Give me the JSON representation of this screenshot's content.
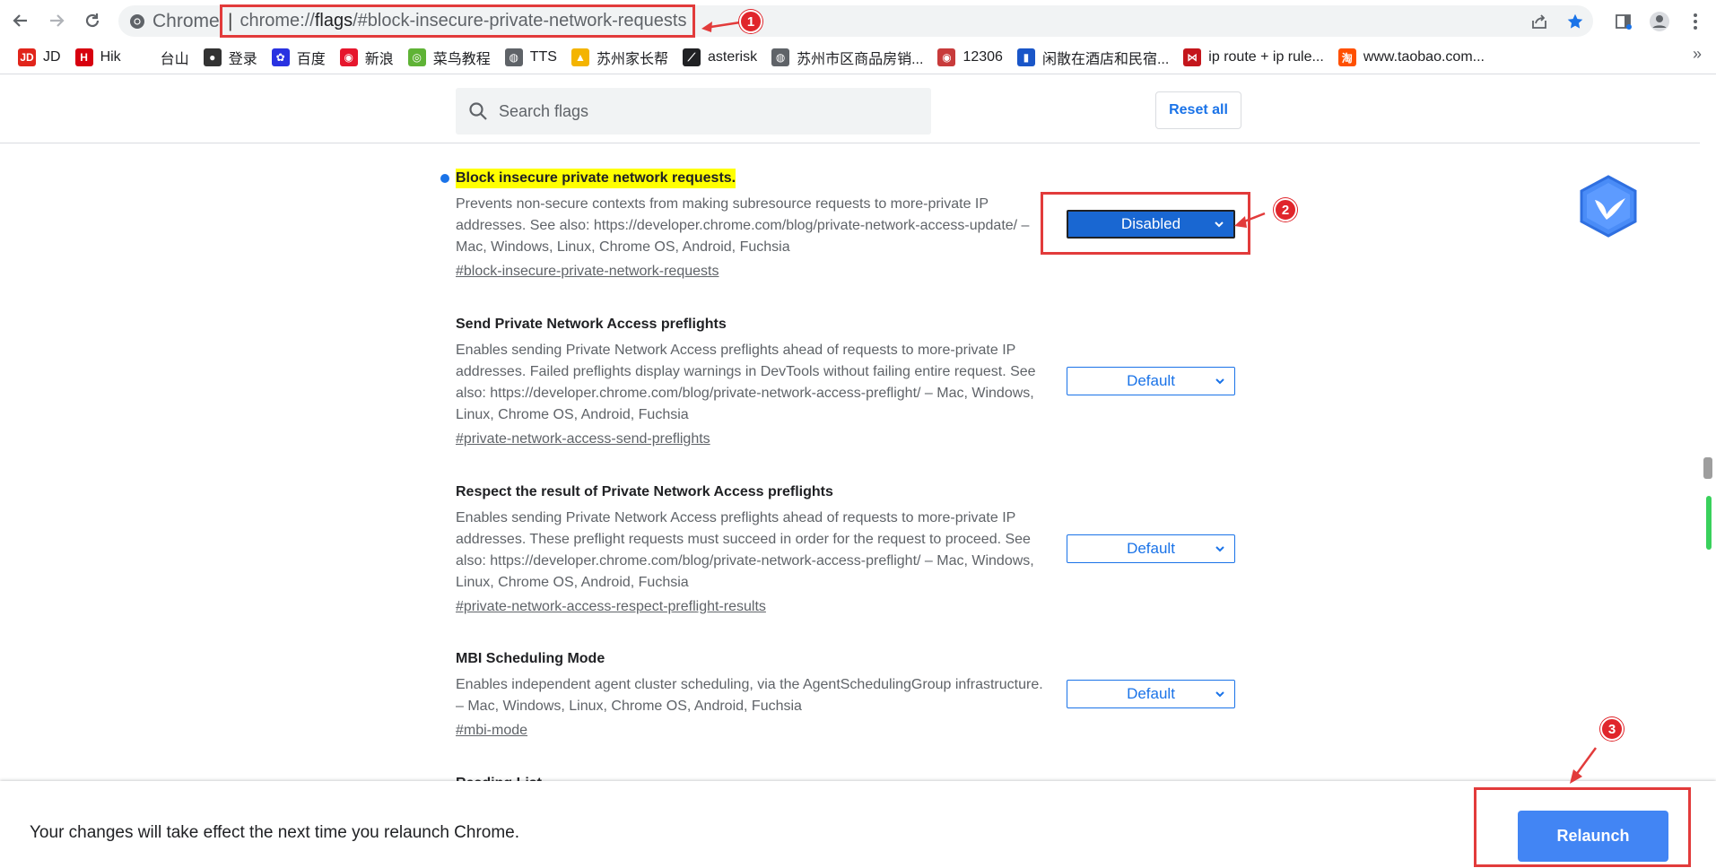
{
  "toolbar": {
    "back_icon": "arrow-left-icon",
    "forward_icon": "arrow-right-icon",
    "reload_icon": "reload-icon",
    "site_label": "Chrome",
    "url_scheme": "chrome://",
    "url_host": "flags",
    "url_rest": "/#block-insecure-private-network-requests"
  },
  "annotations": {
    "badge_1": "1",
    "badge_2": "2",
    "badge_3": "3",
    "color": "#e23b3b"
  },
  "bookmarks": [
    {
      "label": "JD",
      "icon": "JD",
      "color": "#e1251b"
    },
    {
      "label": "Hik",
      "icon": "H",
      "color": "#d7000f"
    },
    {
      "label": "台山",
      "icon": "",
      "color": "#ffffff"
    },
    {
      "label": "登录",
      "icon": "●",
      "color": "#333333"
    },
    {
      "label": "百度",
      "icon": "✿",
      "color": "#2932e1"
    },
    {
      "label": "新浪",
      "icon": "◉",
      "color": "#e6162d"
    },
    {
      "label": "菜鸟教程",
      "icon": "◎",
      "color": "#5fb336"
    },
    {
      "label": "TTS",
      "icon": "◍",
      "color": "#5f6368"
    },
    {
      "label": "苏州家长帮",
      "icon": "▲",
      "color": "#f4b400"
    },
    {
      "label": "asterisk",
      "icon": "⟋",
      "color": "#202124"
    },
    {
      "label": "苏州市区商品房销...",
      "icon": "◍",
      "color": "#5f6368"
    },
    {
      "label": "12306",
      "icon": "◉",
      "color": "#c83b3b"
    },
    {
      "label": "闲散在酒店和民宿...",
      "icon": "▮",
      "color": "#1a56c8"
    },
    {
      "label": "ip route + ip rule...",
      "icon": "⋈",
      "color": "#c4161c"
    },
    {
      "label": "www.taobao.com...",
      "icon": "淘",
      "color": "#ff5000"
    }
  ],
  "bookmarks_more": "»",
  "search": {
    "placeholder": "Search flags",
    "reset_label": "Reset all"
  },
  "experiments": [
    {
      "title": "Block insecure private network requests.",
      "description": "Prevents non-secure contexts from making subresource requests to more-private IP addresses. See also: https://developer.chrome.com/blog/private-network-access-update/ – Mac, Windows, Linux, Chrome OS, Android, Fuchsia",
      "link": "#block-insecure-private-network-requests",
      "value": "Disabled"
    },
    {
      "title": "Send Private Network Access preflights",
      "description": "Enables sending Private Network Access preflights ahead of requests to more-private IP addresses. Failed preflights display warnings in DevTools without failing entire request. See also: https://developer.chrome.com/blog/private-network-access-preflight/ – Mac, Windows, Linux, Chrome OS, Android, Fuchsia",
      "link": "#private-network-access-send-preflights",
      "value": "Default"
    },
    {
      "title": "Respect the result of Private Network Access preflights",
      "description": "Enables sending Private Network Access preflights ahead of requests to more-private IP addresses. These preflight requests must succeed in order for the request to proceed. See also: https://developer.chrome.com/blog/private-network-access-preflight/ – Mac, Windows, Linux, Chrome OS, Android, Fuchsia",
      "link": "#private-network-access-respect-preflight-results",
      "value": "Default"
    },
    {
      "title": "MBI Scheduling Mode",
      "description": "Enables independent agent cluster scheduling, via the AgentSchedulingGroup infrastructure. – Mac, Windows, Linux, Chrome OS, Android, Fuchsia",
      "link": "#mbi-mode",
      "value": "Default"
    },
    {
      "title": "Reading List",
      "description": "",
      "link": "",
      "value": ""
    }
  ],
  "relaunch": {
    "message": "Your changes will take effect the next time you relaunch Chrome.",
    "button_label": "Relaunch"
  },
  "colors": {
    "accent": "#1a73e8",
    "relaunch_button": "#4285f4",
    "highlight": "#ffff00"
  }
}
